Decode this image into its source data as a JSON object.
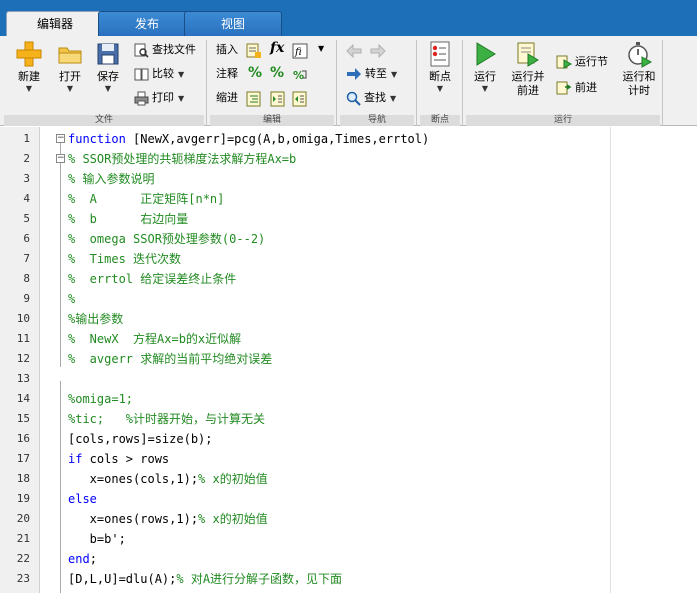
{
  "tabs": [
    {
      "label": "编辑器",
      "active": true
    },
    {
      "label": "发布",
      "active": false
    },
    {
      "label": "视图",
      "active": false
    }
  ],
  "ribbon": {
    "file": {
      "new_label": "新建",
      "open_label": "打开",
      "save_label": "保存",
      "find_files_label": "查找文件",
      "compare_label": "比较",
      "print_label": "打印",
      "group_label": "文件"
    },
    "edit": {
      "insert_label": "插入",
      "comment_label": "注释",
      "indent_label": "缩进",
      "group_label": "编辑"
    },
    "navigate": {
      "goto_label": "转至",
      "find_label": "查找",
      "group_label": "导航"
    },
    "breakpoints": {
      "breakpoints_label": "断点",
      "group_label": "断点"
    },
    "run": {
      "run_label": "运行",
      "run_advance_label_1": "运行并",
      "run_advance_label_2": "前进",
      "run_section_label": "运行节",
      "advance_label": "前进",
      "run_time_label_1": "运行和",
      "run_time_label_2": "计时",
      "group_label": "运行"
    }
  },
  "code_lines": [
    {
      "n": "1",
      "text": "function [NewX,avgerr]=pcg(A,b,omiga,Times,errtol)",
      "kw": "function",
      "rest": " [NewX,avgerr]=pcg(A,b,omiga,Times,errtol)",
      "type": "kw"
    },
    {
      "n": "2",
      "text": "% SSOR预处理的共轭梯度法求解方程Ax=b",
      "type": "cmt"
    },
    {
      "n": "3",
      "text": "% 输入参数说明",
      "type": "cmt"
    },
    {
      "n": "4",
      "text": "%  A      正定矩阵[n*n]",
      "type": "cmt"
    },
    {
      "n": "5",
      "text": "%  b      右边向量",
      "type": "cmt"
    },
    {
      "n": "6",
      "text": "%  omega SSOR预处理参数(0--2)",
      "type": "cmt"
    },
    {
      "n": "7",
      "text": "%  Times 迭代次数",
      "type": "cmt"
    },
    {
      "n": "8",
      "text": "%  errtol 给定误差终止条件",
      "type": "cmt"
    },
    {
      "n": "9",
      "text": "%",
      "type": "cmt"
    },
    {
      "n": "10",
      "text": "%输出参数",
      "type": "cmt"
    },
    {
      "n": "11",
      "text": "%  NewX  方程Ax=b的x近似解",
      "type": "cmt"
    },
    {
      "n": "12",
      "text": "%  avgerr 求解的当前平均绝对误差",
      "type": "cmt"
    },
    {
      "n": "13",
      "text": "",
      "type": "plain"
    },
    {
      "n": "14",
      "text": "%omiga=1;",
      "type": "cmt"
    },
    {
      "n": "15",
      "text": "%tic;   %计时器开始，与计算无关",
      "type": "cmt"
    },
    {
      "n": "16",
      "text": "[cols,rows]=size(b);",
      "type": "plain"
    },
    {
      "n": "17",
      "kw": "if",
      "rest": " cols > rows",
      "type": "kw"
    },
    {
      "n": "18",
      "text": "   x=ones(cols,1);",
      "cmt": "% x的初始值",
      "type": "mixed"
    },
    {
      "n": "19",
      "kw": "else",
      "rest": "",
      "type": "kw"
    },
    {
      "n": "20",
      "text": "   x=ones(rows,1);",
      "cmt": "% x的初始值",
      "type": "mixed"
    },
    {
      "n": "21",
      "text": "   b=b';",
      "type": "plain"
    },
    {
      "n": "22",
      "kw": "end",
      "rest": ";",
      "type": "kw"
    },
    {
      "n": "23",
      "text": "[D,L,U]=dlu(A);",
      "cmt": "% 对A进行分解子函数，见下面",
      "type": "mixed"
    }
  ]
}
